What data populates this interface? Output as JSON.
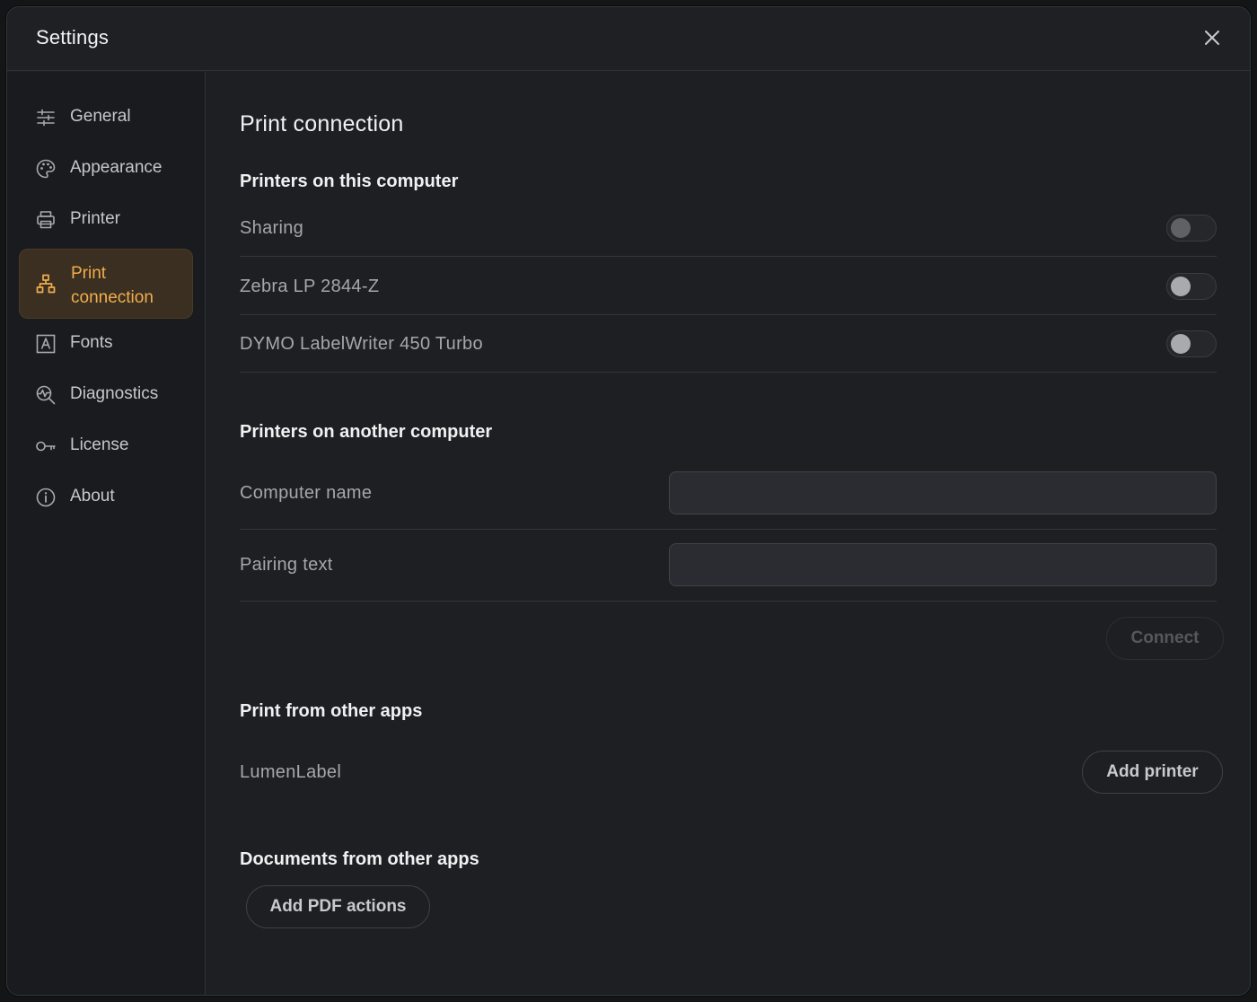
{
  "window": {
    "title": "Settings",
    "close_icon": "close-icon"
  },
  "sidebar": {
    "items": [
      {
        "label": "General",
        "icon": "sliders-icon",
        "active": false
      },
      {
        "label": "Appearance",
        "icon": "palette-icon",
        "active": false
      },
      {
        "label": "Printer",
        "icon": "printer-icon",
        "active": false
      },
      {
        "label": "Print connection",
        "icon": "network-icon",
        "active": true
      },
      {
        "label": "Fonts",
        "icon": "font-icon",
        "active": false
      },
      {
        "label": "Diagnostics",
        "icon": "diagnostics-icon",
        "active": false
      },
      {
        "label": "License",
        "icon": "key-icon",
        "active": false
      },
      {
        "label": "About",
        "icon": "info-icon",
        "active": false
      }
    ],
    "active_color": "#f2ad4e"
  },
  "main": {
    "title": "Print connection",
    "local_printers": {
      "heading": "Printers on this computer",
      "rows": [
        {
          "label": "Sharing",
          "on": false
        },
        {
          "label": "Zebra LP 2844-Z",
          "on": false
        },
        {
          "label": "DYMO LabelWriter 450 Turbo",
          "on": false
        }
      ]
    },
    "remote_printers": {
      "heading": "Printers on another computer",
      "computer_name_label": "Computer name",
      "computer_name_value": "",
      "pairing_text_label": "Pairing text",
      "pairing_text_value": "",
      "connect_label": "Connect"
    },
    "other_apps": {
      "heading": "Print from other apps",
      "app_name": "LumenLabel",
      "add_printer_label": "Add printer"
    },
    "documents": {
      "heading": "Documents from other apps",
      "add_pdf_label": "Add PDF actions"
    }
  }
}
